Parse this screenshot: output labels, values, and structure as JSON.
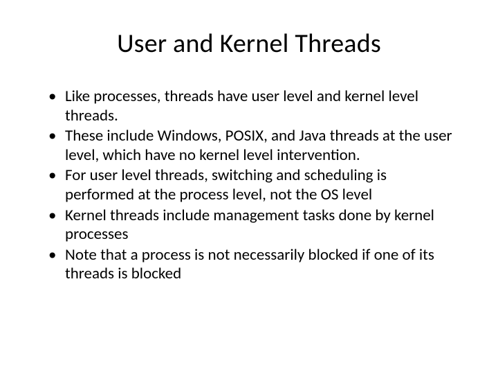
{
  "slide": {
    "title": "User and Kernel Threads",
    "bullets": [
      "Like processes, threads have user level and kernel level threads.",
      "These include Windows, POSIX, and Java threads at the user level, which have no kernel level intervention.",
      "For user level threads, switching and scheduling is performed at the process level, not the OS level",
      "Kernel threads include management tasks done by kernel processes",
      "Note that a process is not necessarily blocked if one of its threads is blocked"
    ]
  }
}
